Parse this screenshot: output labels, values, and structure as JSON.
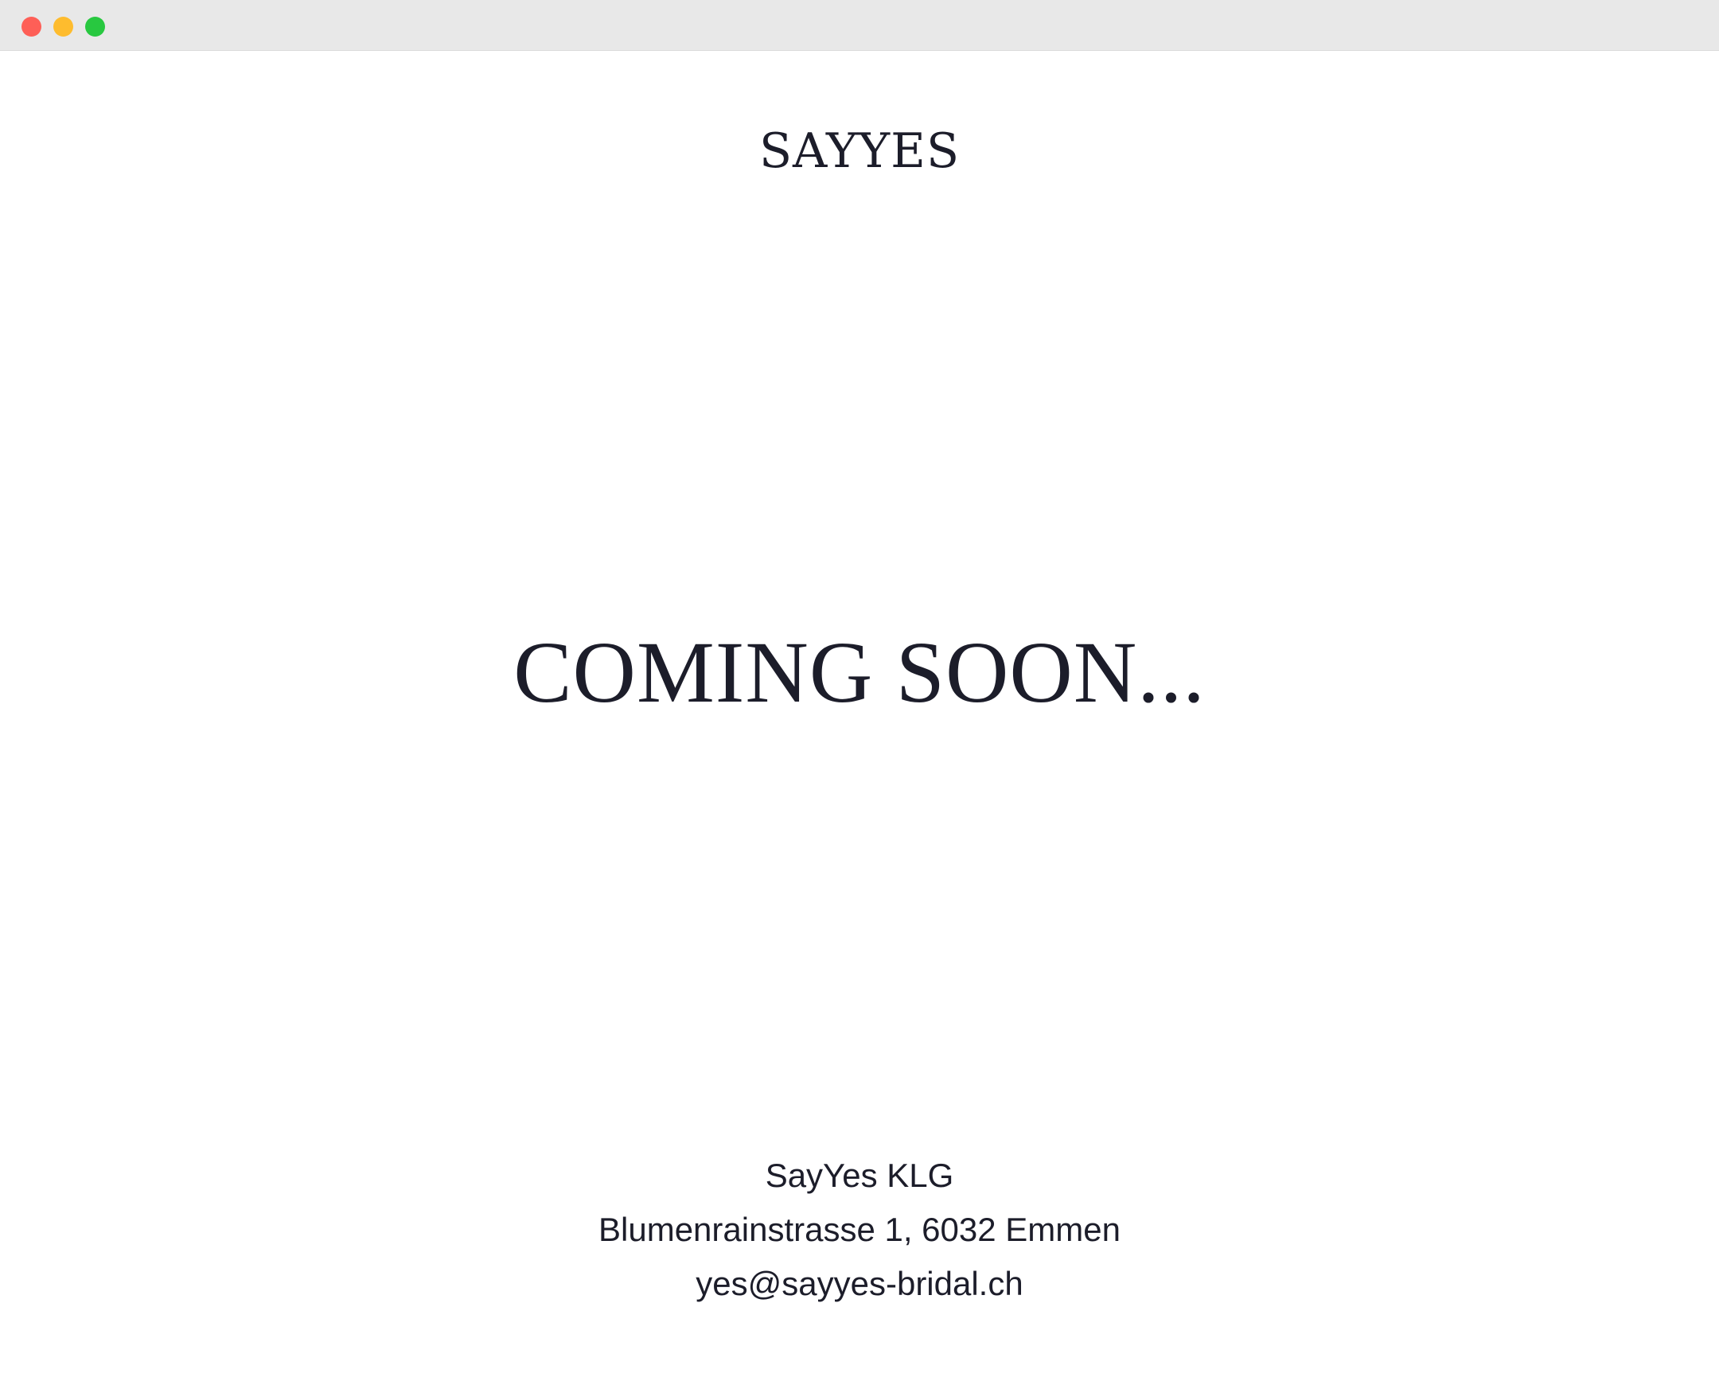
{
  "window": {
    "controls": [
      {
        "name": "close",
        "color": "#fe5f57"
      },
      {
        "name": "minimize",
        "color": "#febc2e"
      },
      {
        "name": "zoom",
        "color": "#28c840"
      }
    ]
  },
  "header": {
    "logo_text": "SAYYES"
  },
  "main": {
    "headline": "COMING SOON..."
  },
  "footer": {
    "company": "SayYes KLG",
    "address": "Blumenrainstrasse 1, 6032 Emmen",
    "email": "yes@sayyes-bridal.ch"
  },
  "colors": {
    "text": "#1c1d2a",
    "background": "#ffffff",
    "titlebar": "#e8e8e8"
  }
}
